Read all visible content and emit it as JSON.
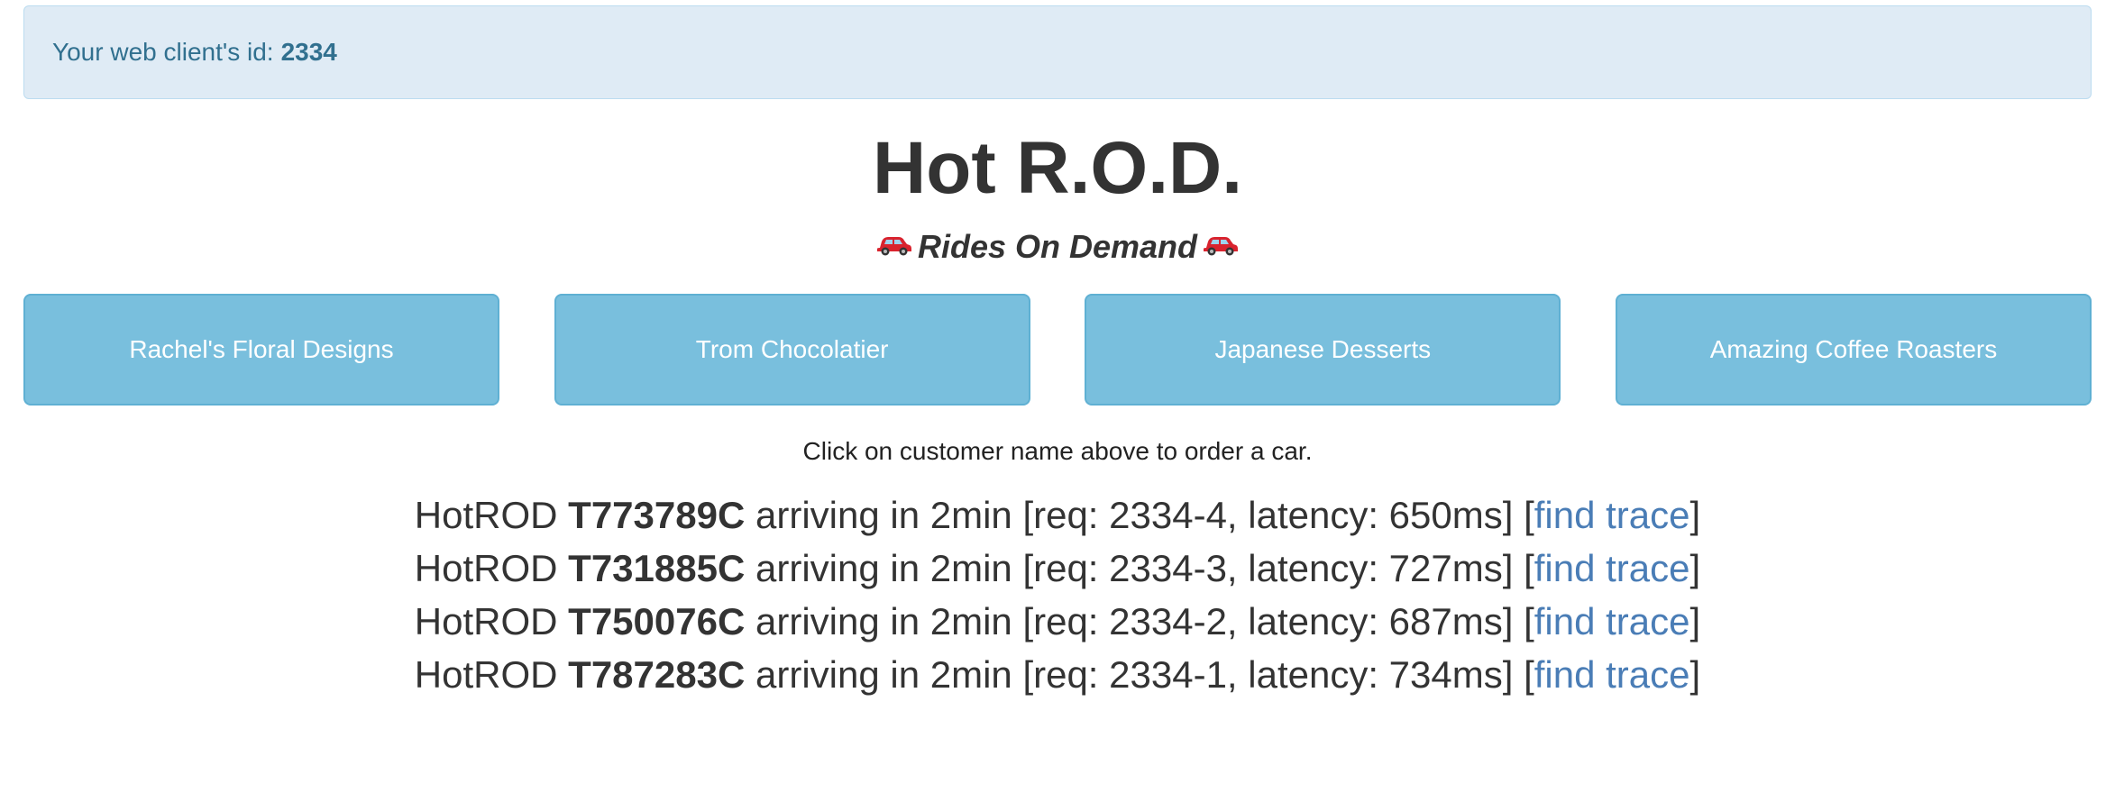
{
  "alert": {
    "label": "Your web client's id:",
    "client_id": "2334"
  },
  "header": {
    "title": "Hot R.O.D.",
    "subtitle": "Rides On Demand"
  },
  "customers": [
    {
      "label": "Rachel's Floral Designs"
    },
    {
      "label": "Trom Chocolatier"
    },
    {
      "label": "Japanese Desserts"
    },
    {
      "label": "Amazing Coffee Roasters"
    }
  ],
  "hint": "Click on customer name above to order a car.",
  "rides": [
    {
      "prefix": "HotROD",
      "car": "T773789C",
      "eta": "arriving in 2min",
      "details": "[req: 2334-4, latency: 650ms] [",
      "link": "find trace",
      "suffix": "]"
    },
    {
      "prefix": "HotROD",
      "car": "T731885C",
      "eta": "arriving in 2min",
      "details": "[req: 2334-3, latency: 727ms] [",
      "link": "find trace",
      "suffix": "]"
    },
    {
      "prefix": "HotROD",
      "car": "T750076C",
      "eta": "arriving in 2min",
      "details": "[req: 2334-2, latency: 687ms] [",
      "link": "find trace",
      "suffix": "]"
    },
    {
      "prefix": "HotROD",
      "car": "T787283C",
      "eta": "arriving in 2min",
      "details": "[req: 2334-1, latency: 734ms] [",
      "link": "find trace",
      "suffix": "]"
    }
  ],
  "colors": {
    "alert_bg": "#dfebf5",
    "alert_text": "#31708f",
    "button_bg": "#79bfdd",
    "link": "#4a7db6"
  },
  "icons": {
    "subtitle_left": "red-car-icon",
    "subtitle_right": "red-car-icon"
  }
}
